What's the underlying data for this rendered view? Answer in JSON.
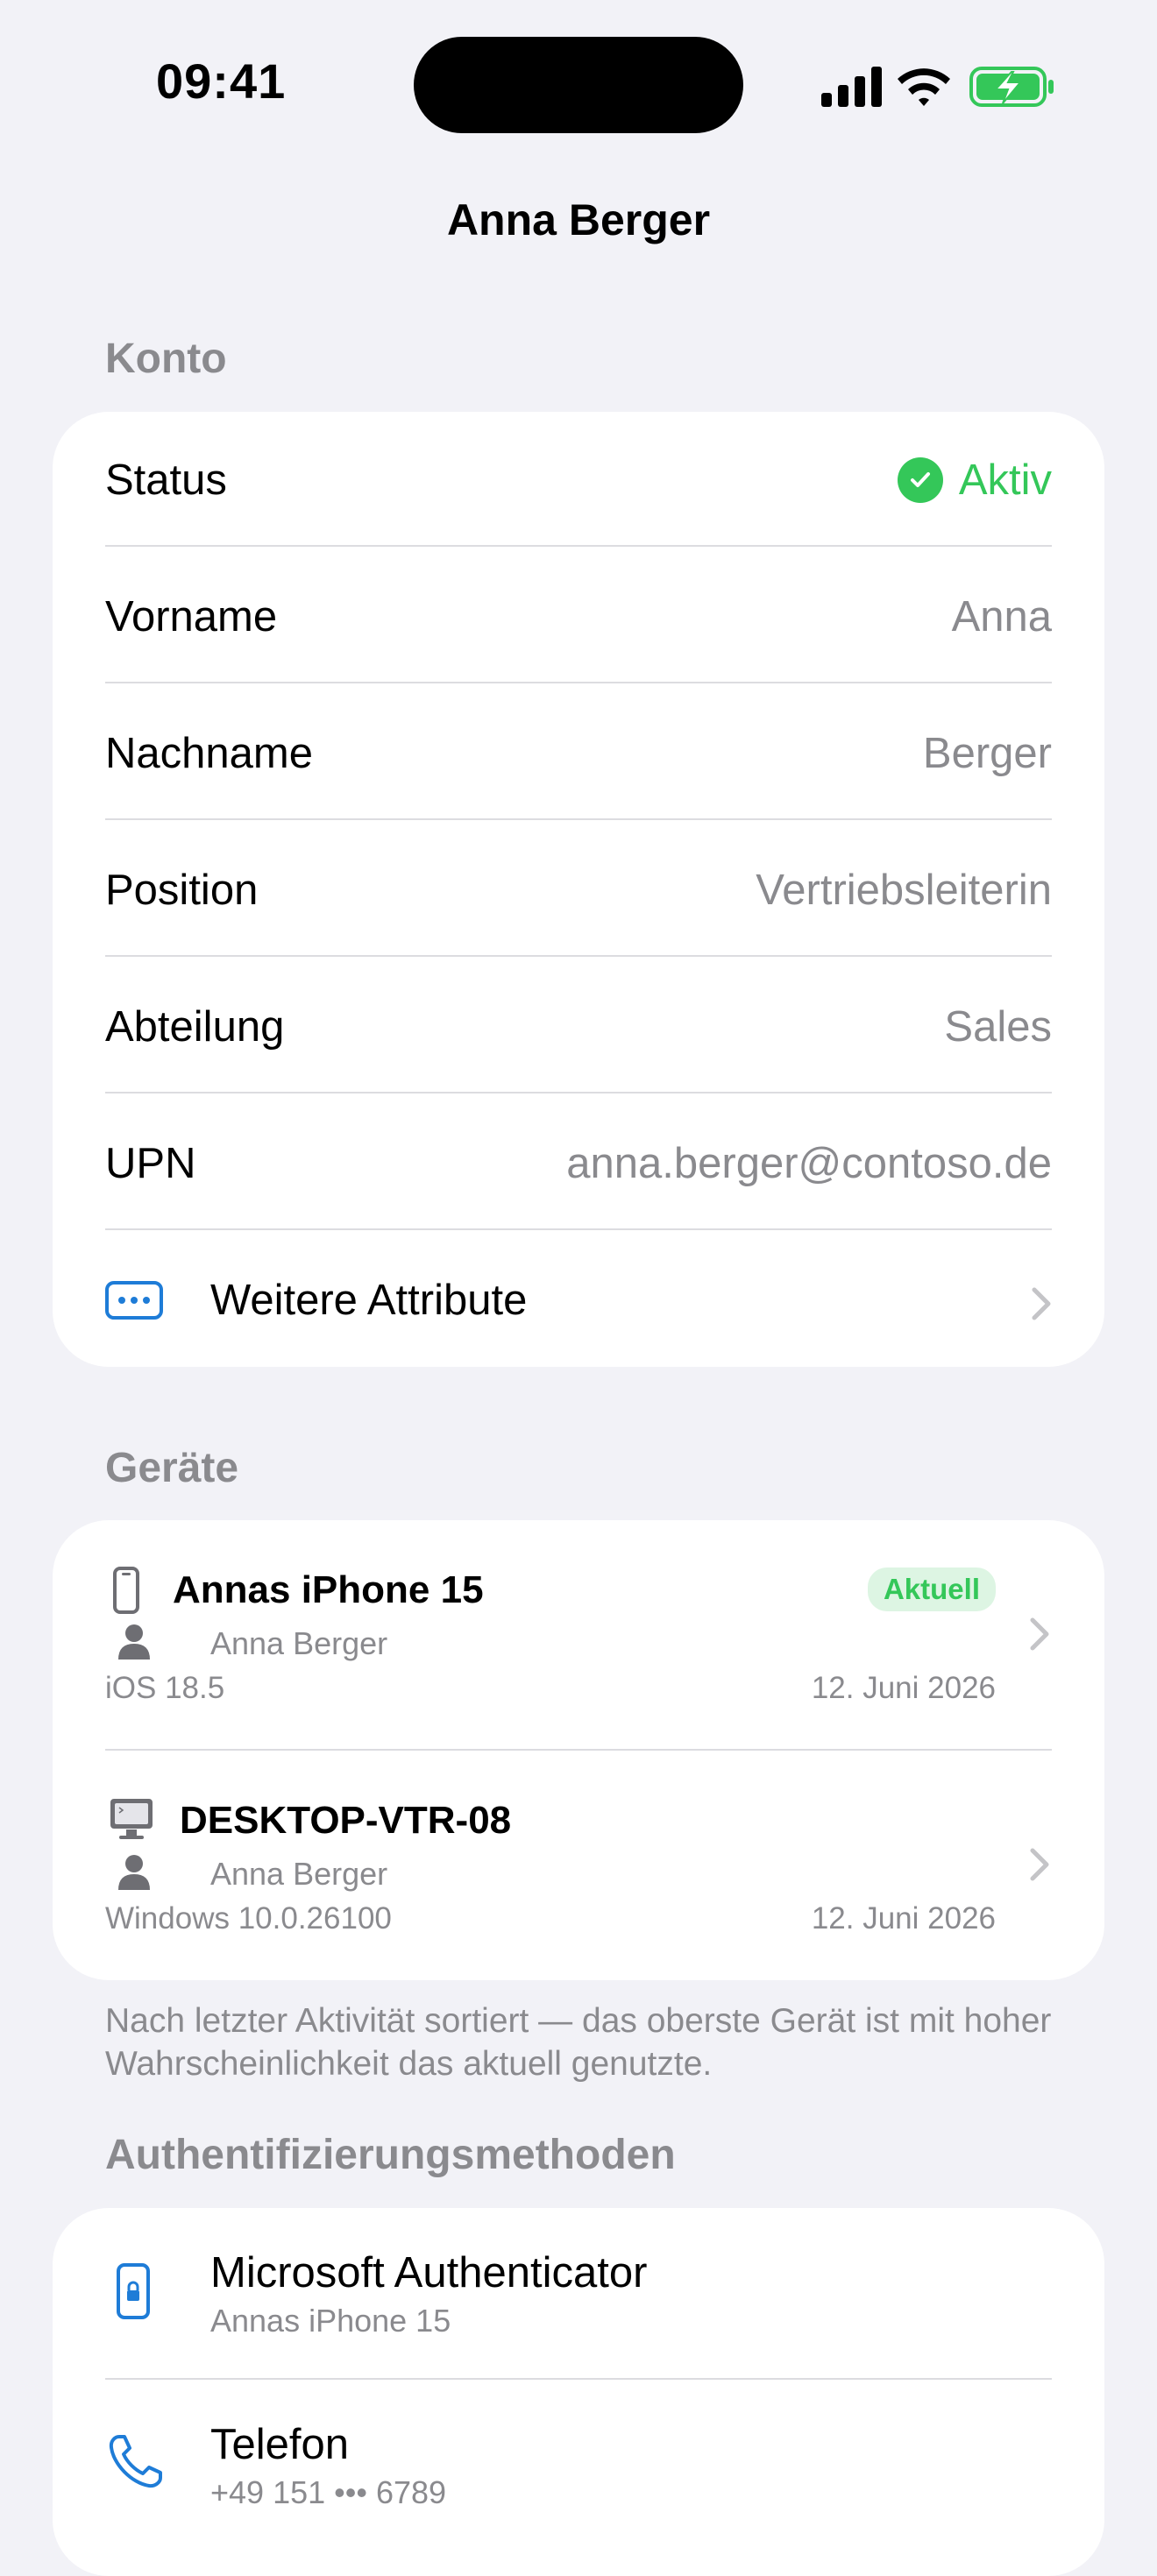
{
  "status_bar": {
    "time": "09:41"
  },
  "nav": {
    "title": "Anna Berger"
  },
  "konto": {
    "header": "Konto",
    "rows": [
      {
        "label": "Status",
        "value": "Aktiv"
      },
      {
        "label": "Vorname",
        "value": "Anna"
      },
      {
        "label": "Nachname",
        "value": "Berger"
      },
      {
        "label": "Position",
        "value": "Vertriebsleiterin"
      },
      {
        "label": "Abteilung",
        "value": "Sales"
      },
      {
        "label": "UPN",
        "value": "anna.berger@contoso.de"
      }
    ],
    "more_label": "Weitere Attribute"
  },
  "geraete": {
    "header": "Geräte",
    "devices": [
      {
        "name": "Annas iPhone 15",
        "badge": "Aktuell",
        "user": "Anna Berger",
        "os": "iOS 18.5",
        "date": "12. Juni 2026",
        "icon": "iphone-icon"
      },
      {
        "name": "DESKTOP-VTR-08",
        "user": "Anna Berger",
        "os": "Windows 10.0.26100",
        "date": "12. Juni 2026",
        "icon": "desktop-computer-icon"
      }
    ],
    "footnote": "Nach letzter Aktivität sortiert — das oberste Gerät ist mit hoher Wahrscheinlichkeit das aktuell genutzte."
  },
  "auth": {
    "header": "Authentifizierungsmethoden",
    "methods": [
      {
        "title": "Microsoft Authenticator",
        "subtitle": "Annas iPhone 15",
        "icon": "authenticator-phone-lock-icon"
      },
      {
        "title": "Telefon",
        "subtitle": "+49 151 ••• 6789",
        "icon": "phone-handset-icon"
      }
    ]
  },
  "colors": {
    "accent_blue": "#1E7CD7",
    "status_green": "#34C759",
    "secondary_text": "#8A8A8E",
    "background": "#F2F2F7"
  }
}
